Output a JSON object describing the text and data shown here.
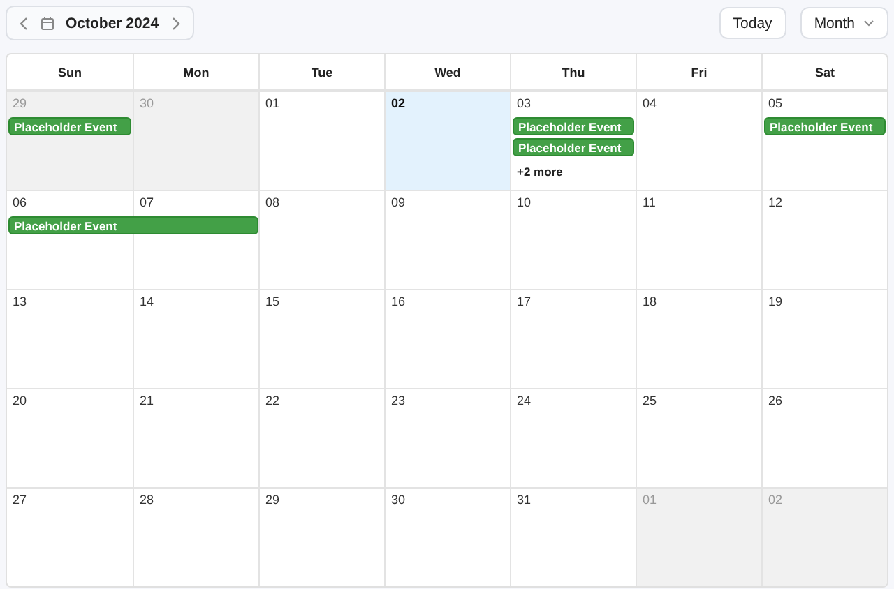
{
  "toolbar": {
    "title": "October 2024",
    "today_button": "Today",
    "view_select": "Month"
  },
  "weekdays": [
    "Sun",
    "Mon",
    "Tue",
    "Wed",
    "Thu",
    "Fri",
    "Sat"
  ],
  "weeks": [
    {
      "days": [
        {
          "label": "29",
          "outside": true,
          "today": false,
          "events": [
            {
              "title": "Placeholder Event",
              "continues": false
            }
          ]
        },
        {
          "label": "30",
          "outside": true,
          "today": false
        },
        {
          "label": "01",
          "outside": false,
          "today": false
        },
        {
          "label": "02",
          "outside": false,
          "today": true
        },
        {
          "label": "03",
          "outside": false,
          "today": false,
          "events": [
            {
              "title": "Placeholder Event",
              "continues": false
            },
            {
              "title": "Placeholder Event",
              "continues": false
            }
          ],
          "more": "+2 more"
        },
        {
          "label": "04",
          "outside": false,
          "today": false
        },
        {
          "label": "05",
          "outside": false,
          "today": false,
          "events": [
            {
              "title": "Placeholder Event",
              "continues": false
            }
          ]
        }
      ]
    },
    {
      "days": [
        {
          "label": "06",
          "outside": false,
          "today": false,
          "events": [
            {
              "title": "Placeholder Event",
              "continues": true
            }
          ]
        },
        {
          "label": "07",
          "outside": false,
          "today": false
        },
        {
          "label": "08",
          "outside": false,
          "today": false
        },
        {
          "label": "09",
          "outside": false,
          "today": false
        },
        {
          "label": "10",
          "outside": false,
          "today": false
        },
        {
          "label": "11",
          "outside": false,
          "today": false
        },
        {
          "label": "12",
          "outside": false,
          "today": false
        }
      ]
    },
    {
      "days": [
        {
          "label": "13",
          "outside": false,
          "today": false
        },
        {
          "label": "14",
          "outside": false,
          "today": false
        },
        {
          "label": "15",
          "outside": false,
          "today": false
        },
        {
          "label": "16",
          "outside": false,
          "today": false
        },
        {
          "label": "17",
          "outside": false,
          "today": false
        },
        {
          "label": "18",
          "outside": false,
          "today": false
        },
        {
          "label": "19",
          "outside": false,
          "today": false
        }
      ]
    },
    {
      "days": [
        {
          "label": "20",
          "outside": false,
          "today": false
        },
        {
          "label": "21",
          "outside": false,
          "today": false
        },
        {
          "label": "22",
          "outside": false,
          "today": false
        },
        {
          "label": "23",
          "outside": false,
          "today": false
        },
        {
          "label": "24",
          "outside": false,
          "today": false
        },
        {
          "label": "25",
          "outside": false,
          "today": false
        },
        {
          "label": "26",
          "outside": false,
          "today": false
        }
      ]
    },
    {
      "days": [
        {
          "label": "27",
          "outside": false,
          "today": false
        },
        {
          "label": "28",
          "outside": false,
          "today": false
        },
        {
          "label": "29",
          "outside": false,
          "today": false
        },
        {
          "label": "30",
          "outside": false,
          "today": false
        },
        {
          "label": "31",
          "outside": false,
          "today": false
        },
        {
          "label": "01",
          "outside": true,
          "today": false
        },
        {
          "label": "02",
          "outside": true,
          "today": false
        }
      ]
    }
  ]
}
